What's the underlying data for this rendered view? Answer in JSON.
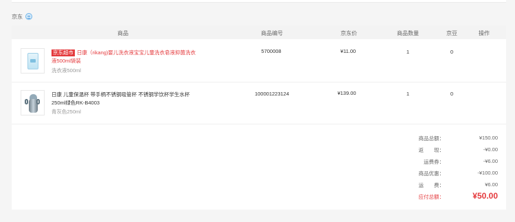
{
  "shop": {
    "name": "京东",
    "chat_icon": "chat-bubble-icon"
  },
  "table": {
    "headers": [
      "商品",
      "商品编号",
      "京东价",
      "商品数量",
      "京豆",
      "操作"
    ]
  },
  "items": [
    {
      "badge": "京东超市",
      "title": "日康（rikang)婴儿洗衣液宝宝儿童洗衣皂液抑菌洗衣液500ml袋装",
      "spec": "洗衣液500ml",
      "sku": "5700008",
      "price": "¥11.00",
      "qty": "1",
      "beans": "0",
      "image": "detergent-pouch-image"
    },
    {
      "badge": "",
      "title": "日康 儿童保温杯 带手柄不锈钢吸管杯 不锈钢学饮杯学生水杯250ml绿色RK-B4003",
      "spec": "青灰色250ml",
      "sku": "100001223124",
      "price": "¥139.00",
      "qty": "1",
      "beans": "0",
      "image": "sippy-cup-image"
    }
  ],
  "summary": [
    {
      "label": "商品总额：",
      "value": "¥150.00"
    },
    {
      "label": "返　　现：",
      "value": "-¥0.00"
    },
    {
      "label": "运费券：",
      "value": "-¥6.00"
    },
    {
      "label": "商品优惠：",
      "value": "-¥100.00"
    },
    {
      "label": "运　　费：",
      "value": "¥6.00"
    },
    {
      "label": "应付总额：",
      "value": "¥50.00"
    }
  ],
  "colors": {
    "accent": "#e4393c",
    "header_bg": "#f3f3f3",
    "page_bg": "#f5f5f5"
  }
}
